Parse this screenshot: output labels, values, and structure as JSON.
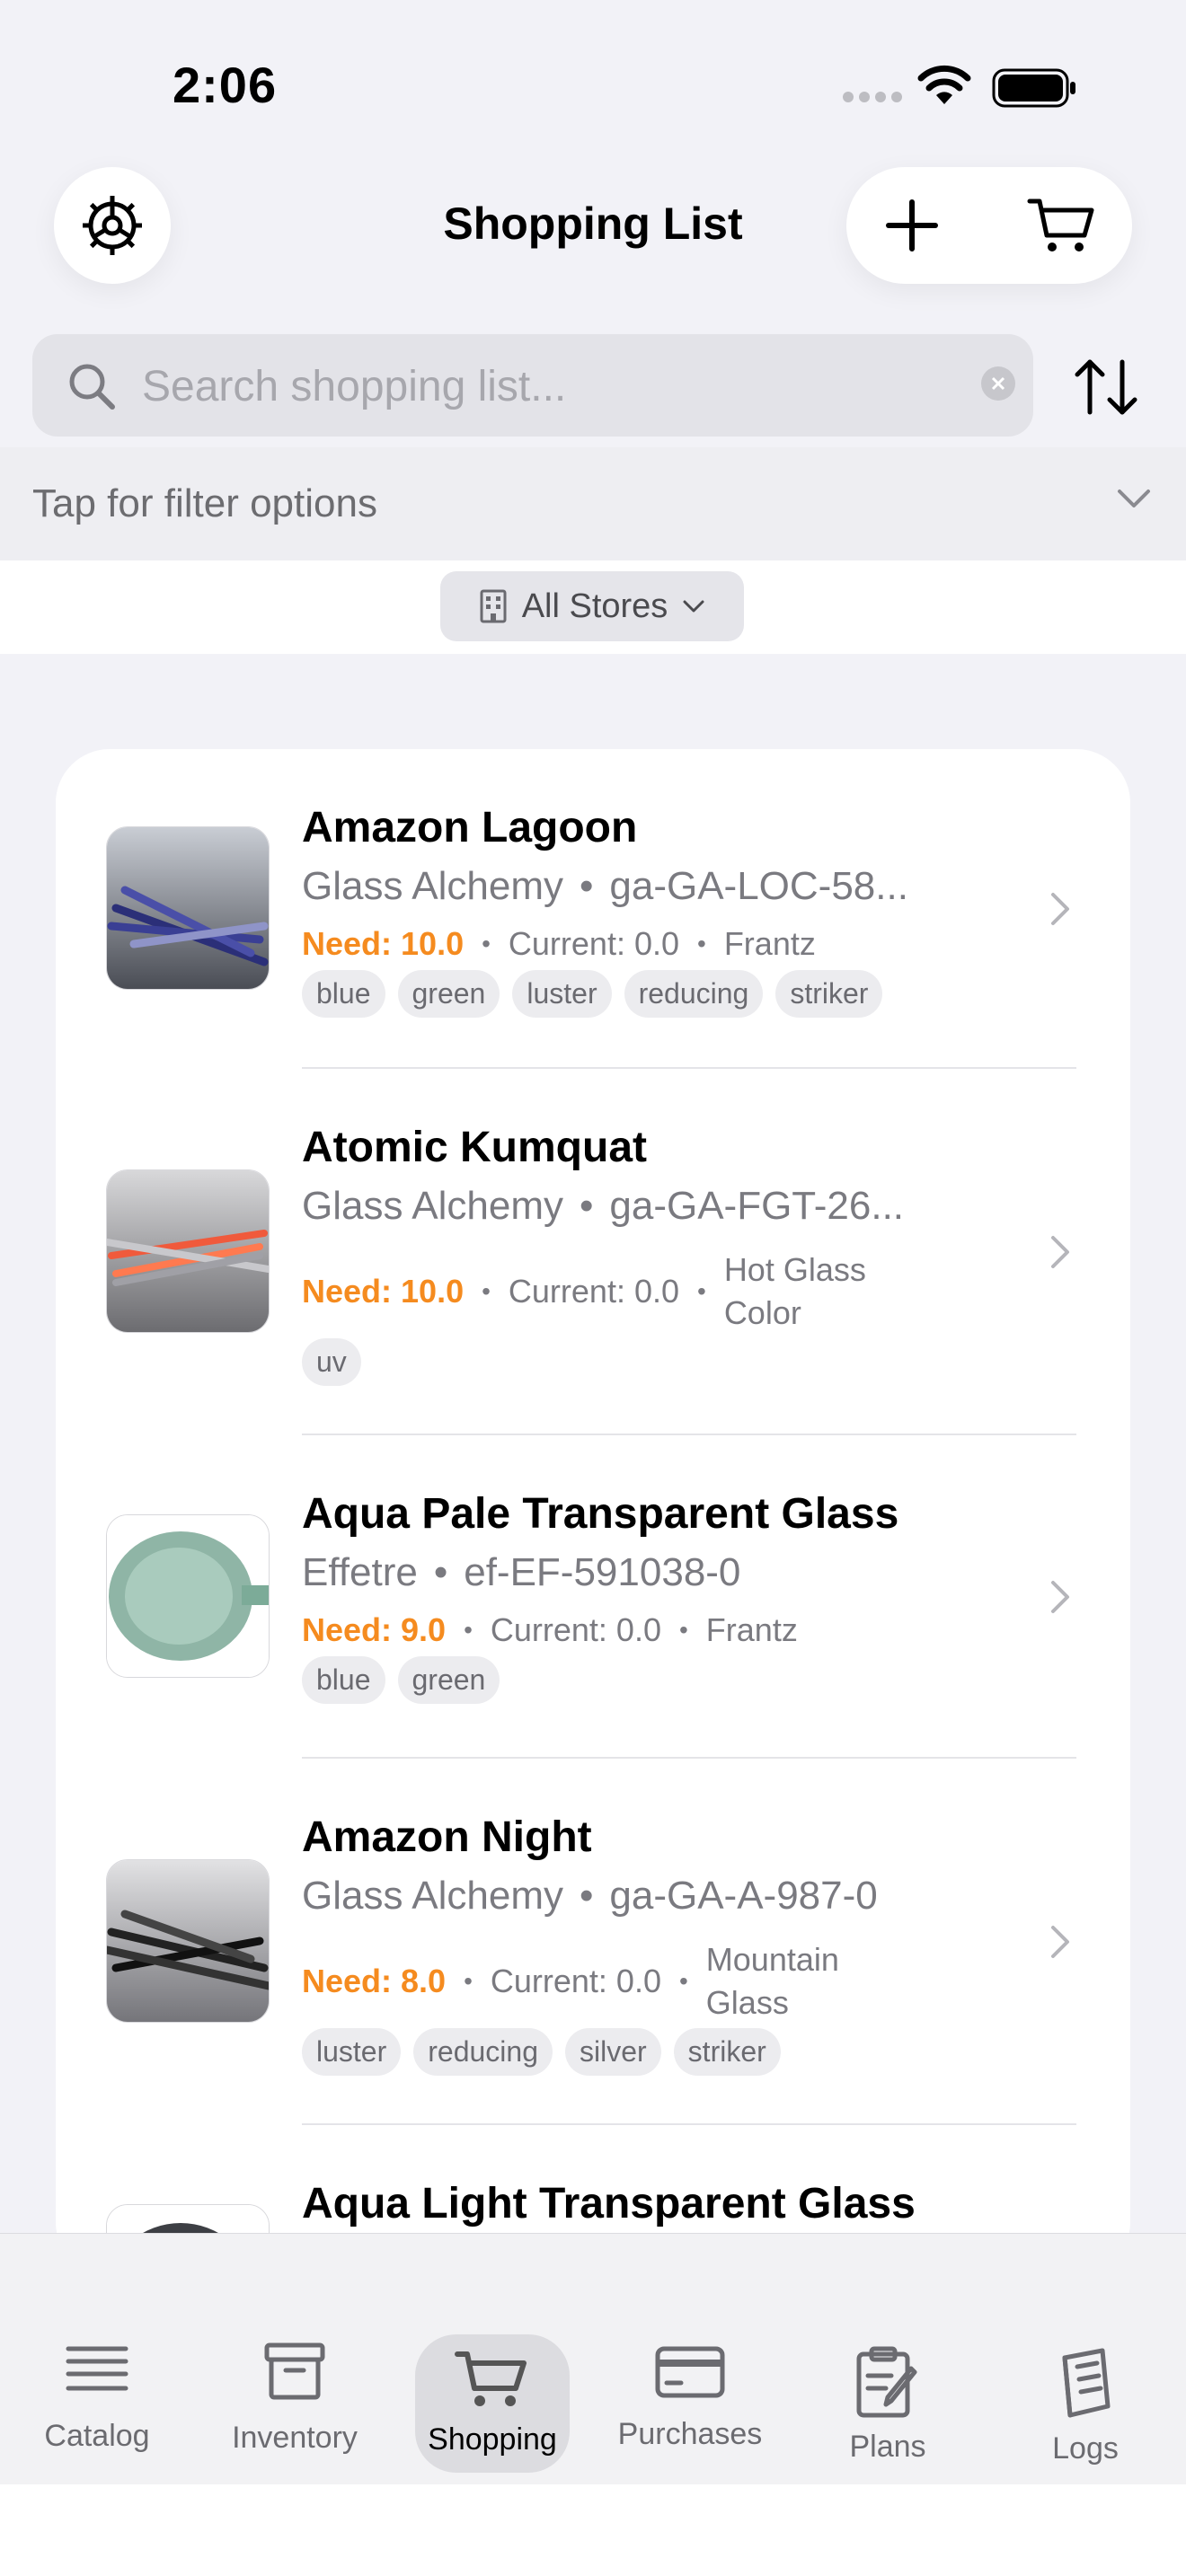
{
  "status_bar": {
    "time": "2:06"
  },
  "header": {
    "title": "Shopping List"
  },
  "search": {
    "placeholder": "Search shopping list...",
    "value": ""
  },
  "filter": {
    "label": "Tap for filter options"
  },
  "store_filter": {
    "label": "All Stores"
  },
  "items": [
    {
      "name": "Amazon Lagoon",
      "manufacturer": "Glass Alchemy",
      "sku": "ga-GA-LOC-58...",
      "need": "Need: 10.0",
      "current": "Current: 0.0",
      "store": "Frantz",
      "tags": [
        "blue",
        "green",
        "luster",
        "reducing",
        "striker"
      ]
    },
    {
      "name": "Atomic Kumquat",
      "manufacturer": "Glass Alchemy",
      "sku": "ga-GA-FGT-26...",
      "need": "Need: 10.0",
      "current": "Current: 0.0",
      "store": "Hot Glass Color",
      "tags": [
        "uv"
      ]
    },
    {
      "name": "Aqua Pale Transparent Glass",
      "manufacturer": "Effetre",
      "sku": "ef-EF-591038-0",
      "need": "Need: 9.0",
      "current": "Current: 0.0",
      "store": "Frantz",
      "tags": [
        "blue",
        "green"
      ]
    },
    {
      "name": "Amazon Night",
      "manufacturer": "Glass Alchemy",
      "sku": "ga-GA-A-987-0",
      "need": "Need: 8.0",
      "current": "Current: 0.0",
      "store": "Mountain Glass",
      "tags": [
        "luster",
        "reducing",
        "silver",
        "striker"
      ]
    },
    {
      "name": "Aqua Light Transparent Glass"
    }
  ],
  "tabs": [
    {
      "label": "Catalog",
      "icon": "list-icon"
    },
    {
      "label": "Inventory",
      "icon": "archive-box-icon"
    },
    {
      "label": "Shopping",
      "icon": "cart-icon",
      "active": true
    },
    {
      "label": "Purchases",
      "icon": "credit-card-icon"
    },
    {
      "label": "Plans",
      "icon": "clipboard-pencil-icon"
    },
    {
      "label": "Logs",
      "icon": "notebook-icon"
    }
  ],
  "colors": {
    "accent": "#f58b1f",
    "background": "#f2f2f7"
  }
}
